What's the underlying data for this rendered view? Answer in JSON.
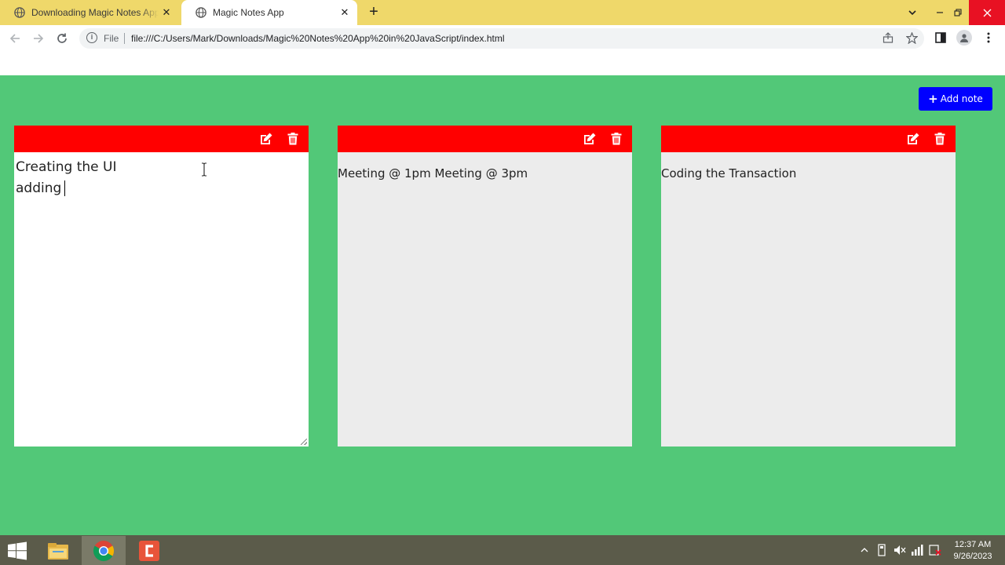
{
  "browser": {
    "tabs": [
      {
        "title": "Downloading Magic Notes App i",
        "active": false
      },
      {
        "title": "Magic Notes App",
        "active": true
      }
    ],
    "omnibox": {
      "scheme_label": "File",
      "url": "file:///C:/Users/Mark/Downloads/Magic%20Notes%20App%20in%20JavaScript/index.html"
    }
  },
  "app": {
    "add_note_label": "Add note",
    "colors": {
      "background": "#52c878",
      "note_header": "#ff0000",
      "add_button": "#0000ff"
    },
    "notes": [
      {
        "lines": [
          "Creating the UI",
          "adding"
        ],
        "editing": true
      },
      {
        "text": "Meeting @ 1pm Meeting @ 3pm",
        "editing": false
      },
      {
        "text": "Coding the Transaction",
        "editing": false
      }
    ]
  },
  "taskbar": {
    "time": "12:37 AM",
    "date": "9/26/2023"
  }
}
